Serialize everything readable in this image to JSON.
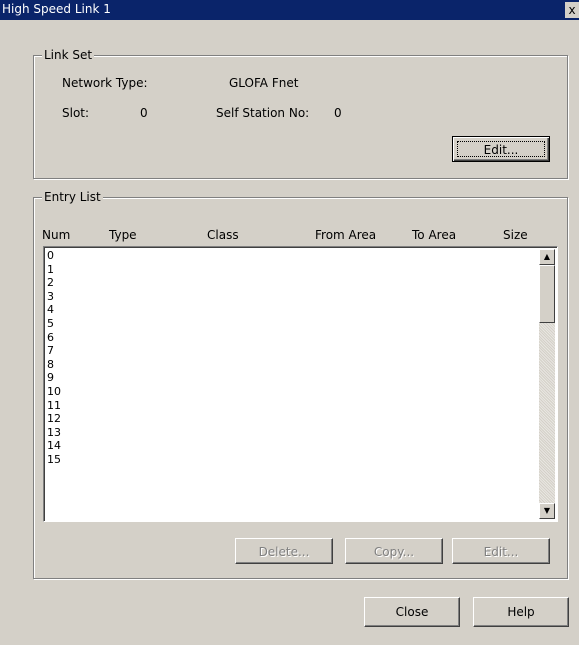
{
  "window": {
    "title": "High Speed Link 1",
    "close_glyph": "x"
  },
  "link_set": {
    "title": "Link Set",
    "network_type_label": "Network Type:",
    "network_type_value": "GLOFA Fnet",
    "slot_label": "Slot:",
    "slot_value": "0",
    "self_station_label": "Self Station No:",
    "self_station_value": "0",
    "edit_button": "Edit..."
  },
  "entry_list": {
    "title": "Entry List",
    "columns": [
      "Num",
      "Type",
      "Class",
      "From Area",
      "To Area",
      "Size"
    ],
    "rows": [
      "0",
      "1",
      "2",
      "3",
      "4",
      "5",
      "6",
      "7",
      "8",
      "9",
      "10",
      "11",
      "12",
      "13",
      "14",
      "15"
    ],
    "scroll_up_glyph": "▲",
    "scroll_down_glyph": "▼",
    "delete_button": "Delete...",
    "copy_button": "Copy...",
    "edit_button": "Edit..."
  },
  "footer": {
    "close_button": "Close",
    "help_button": "Help"
  }
}
